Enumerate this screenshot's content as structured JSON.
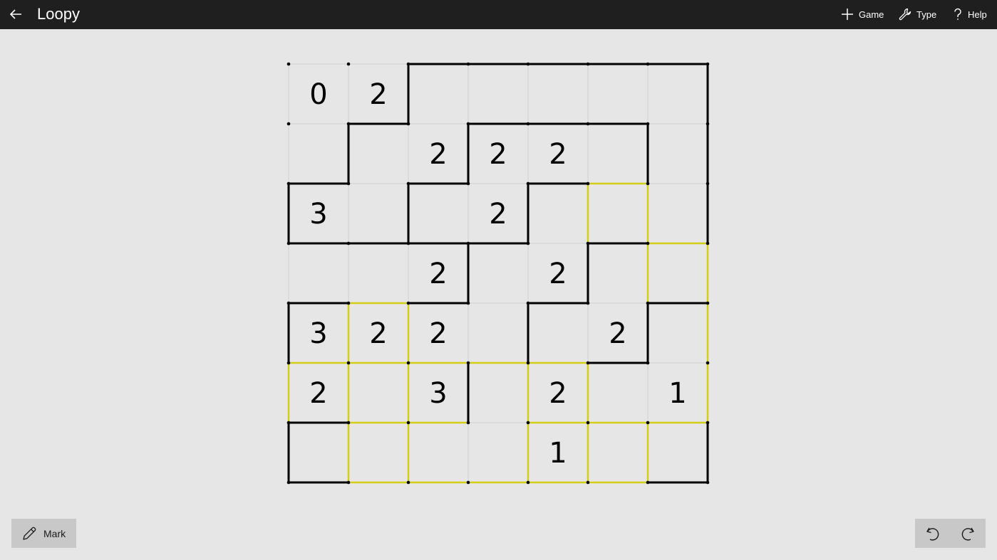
{
  "app": {
    "title": "Loopy"
  },
  "menu": {
    "game_label": "Game",
    "type_label": "Type",
    "help_label": "Help"
  },
  "toolbar": {
    "mark_label": "Mark"
  },
  "colors": {
    "background": "#e6e6e6",
    "titlebar": "#1f1f1f",
    "line": "#000000",
    "highlight": "#d4cf14",
    "grid": "#d0d0d0",
    "button": "#c8c8c8"
  },
  "puzzle": {
    "rows": 7,
    "cols": 7,
    "clues": [
      [
        "0",
        "2",
        "",
        "",
        "",
        "",
        ""
      ],
      [
        "",
        "",
        "2",
        "2",
        "2",
        "",
        ""
      ],
      [
        "3",
        "",
        "",
        "2",
        "",
        "",
        ""
      ],
      [
        "",
        "",
        "2",
        "",
        "2",
        "",
        ""
      ],
      [
        "3",
        "2",
        "2",
        "",
        "",
        "2",
        ""
      ],
      [
        "2",
        "",
        "3",
        "",
        "2",
        "",
        "1"
      ],
      [
        "",
        "",
        "",
        "",
        "1",
        "",
        ""
      ]
    ],
    "h_edges": [
      [
        0,
        0,
        1,
        1,
        1,
        1,
        1
      ],
      [
        0,
        1,
        0,
        1,
        1,
        1,
        0
      ],
      [
        1,
        0,
        1,
        0,
        1,
        2,
        0
      ],
      [
        1,
        1,
        1,
        1,
        0,
        1,
        2
      ],
      [
        1,
        2,
        1,
        0,
        1,
        0,
        1
      ],
      [
        2,
        2,
        2,
        2,
        2,
        1,
        0
      ],
      [
        1,
        2,
        2,
        0,
        2,
        2,
        2
      ],
      [
        1,
        2,
        2,
        2,
        2,
        2,
        1
      ]
    ],
    "v_edges": [
      [
        0,
        0,
        1,
        0,
        0,
        0,
        0,
        1
      ],
      [
        0,
        1,
        0,
        1,
        0,
        0,
        1,
        1
      ],
      [
        1,
        0,
        1,
        0,
        1,
        2,
        2,
        1
      ],
      [
        0,
        0,
        0,
        1,
        0,
        1,
        2,
        2
      ],
      [
        1,
        2,
        2,
        0,
        1,
        0,
        1,
        2
      ],
      [
        2,
        2,
        2,
        1,
        2,
        2,
        0,
        2
      ],
      [
        1,
        2,
        2,
        0,
        2,
        2,
        2,
        1
      ]
    ]
  }
}
